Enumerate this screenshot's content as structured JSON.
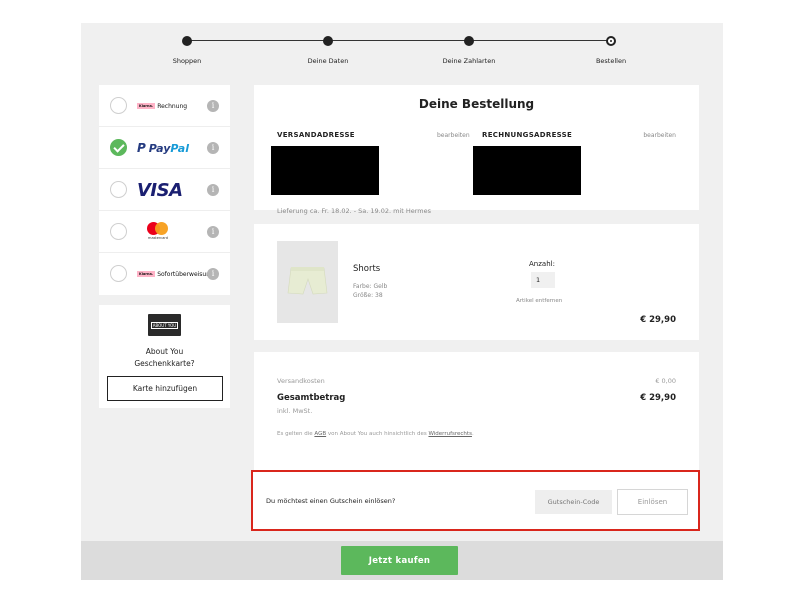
{
  "steps": [
    {
      "label": "Shoppen",
      "state": "done"
    },
    {
      "label": "Deine Daten",
      "state": "done"
    },
    {
      "label": "Deine Zahlarten",
      "state": "done"
    },
    {
      "label": "Bestellen",
      "state": "current"
    }
  ],
  "payment_methods": [
    {
      "name": "Klarna Rechnung",
      "badge": "Klarna.",
      "text": "Rechnung",
      "selected": false,
      "icon": "klarna-logo"
    },
    {
      "name": "PayPal",
      "text": "PayPal",
      "selected": true,
      "icon": "paypal-logo"
    },
    {
      "name": "VISA",
      "text": "VISA",
      "selected": false,
      "icon": "visa-logo"
    },
    {
      "name": "Mastercard",
      "text": "mastercard",
      "selected": false,
      "icon": "mastercard-logo"
    },
    {
      "name": "Klarna Sofortüberweisung",
      "badge": "Klarna.",
      "text": "Sofortüberweisung",
      "selected": false,
      "icon": "klarna-logo"
    }
  ],
  "info_glyph": "i",
  "gift_card": {
    "logo_text": "ABOUT YOU",
    "line1": "About You",
    "line2": "Geschenkkarte?",
    "button": "Karte hinzufügen"
  },
  "order": {
    "title": "Deine Bestellung",
    "shipping_label": "VERSANDADRESSE",
    "billing_label": "RECHNUNGSADRESSE",
    "edit_label": "bearbeiten",
    "delivery": "Lieferung ca. Fr. 18.02. - Sa. 19.02. mit Hermes"
  },
  "product": {
    "name": "Shorts",
    "color": "Farbe: Gelb",
    "size": "Größe: 38",
    "qty_label": "Anzahl:",
    "qty": "1",
    "remove": "Artikel entfernen",
    "price": "€ 29,90"
  },
  "totals": {
    "shipping_label": "Versandkosten",
    "shipping_value": "€ 0,00",
    "total_label": "Gesamtbetrag",
    "total_value": "€ 29,90",
    "vat": "inkl. MwSt.",
    "terms_pre": "Es gelten die ",
    "terms_agb": "AGB",
    "terms_mid": " von About You auch hinsichtlich des ",
    "terms_link": "Widerrufsrechts",
    "terms_end": "."
  },
  "coupon": {
    "question": "Du möchtest einen Gutschein einlösen?",
    "placeholder": "Gutschein-Code",
    "button": "Einlösen"
  },
  "buy_button": "Jetzt kaufen",
  "colors": {
    "accent_green": "#5cb85c",
    "highlight_red": "#d9261c",
    "background": "#f0f0f0"
  }
}
